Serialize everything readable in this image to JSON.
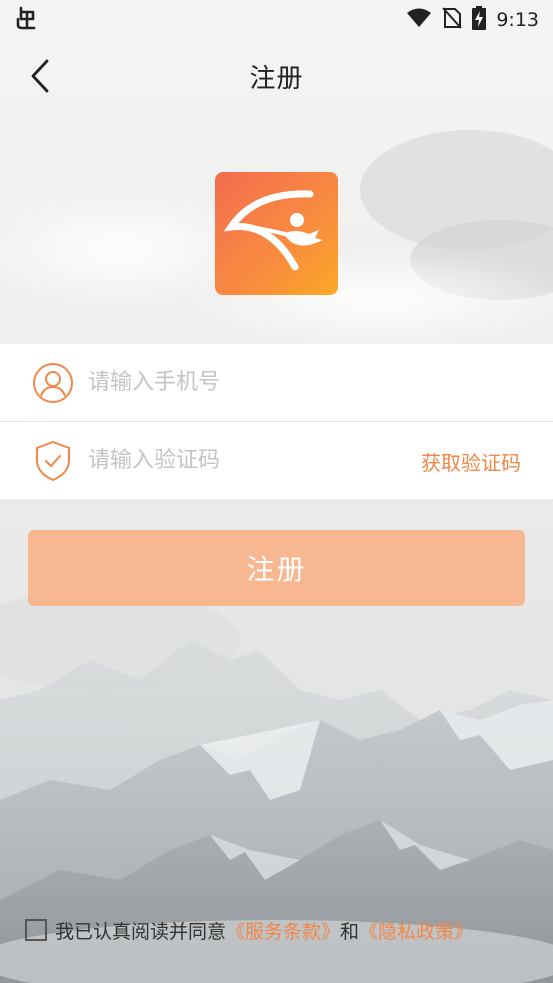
{
  "status_bar": {
    "time": "9:13",
    "left_icon": "bug-icon",
    "icons": [
      "wifi-icon",
      "no-sim-icon",
      "battery-charging-icon"
    ]
  },
  "nav": {
    "title": "注册",
    "back_icon": "back-arrow-icon"
  },
  "logo": {
    "icon": "app-logo-icon",
    "colors": [
      "#f26d4f",
      "#fba826"
    ]
  },
  "form": {
    "phone": {
      "placeholder": "请输入手机号",
      "value": "",
      "icon": "user-icon"
    },
    "code": {
      "placeholder": "请输入验证码",
      "value": "",
      "icon": "shield-check-icon",
      "get_code_label": "获取验证码"
    }
  },
  "submit": {
    "label": "注册",
    "color": "#f7b891"
  },
  "agreement": {
    "checked": false,
    "prefix": "我已认真阅读并同意",
    "terms_link": "《服务条款》",
    "conjunction": "和",
    "privacy_link": "《隐私政策》"
  },
  "colors": {
    "accent": "#f2874a"
  }
}
